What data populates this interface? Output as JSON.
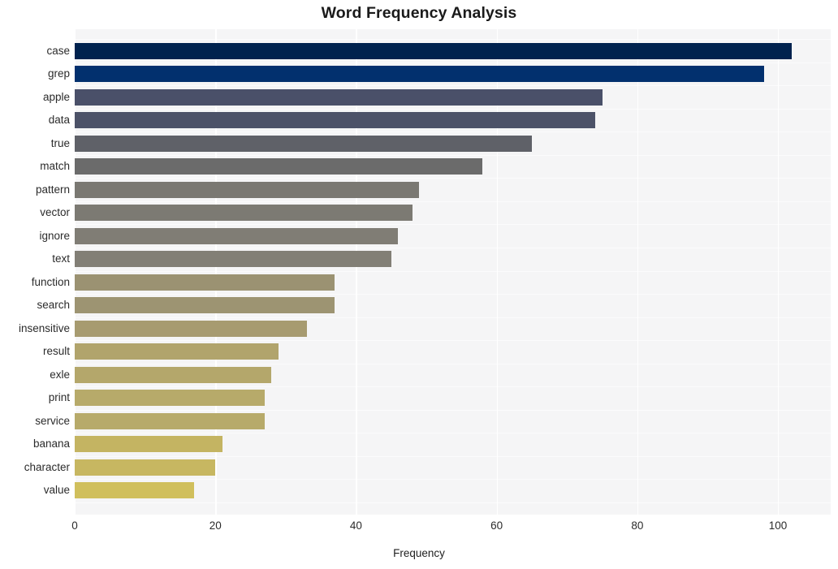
{
  "chart_data": {
    "type": "bar",
    "orientation": "horizontal",
    "title": "Word Frequency Analysis",
    "xlabel": "Frequency",
    "ylabel": "",
    "categories": [
      "case",
      "grep",
      "apple",
      "data",
      "true",
      "match",
      "pattern",
      "vector",
      "ignore",
      "text",
      "function",
      "search",
      "insensitive",
      "result",
      "exle",
      "print",
      "service",
      "banana",
      "character",
      "value"
    ],
    "values": [
      102,
      98,
      75,
      74,
      65,
      58,
      49,
      48,
      46,
      45,
      37,
      37,
      33,
      29,
      28,
      27,
      27,
      21,
      20,
      17
    ],
    "bar_colors": [
      "#00224e",
      "#02306e",
      "#4a5069",
      "#4c5268",
      "#5f6168",
      "#6b6b6b",
      "#7a7872",
      "#7c7a73",
      "#807d75",
      "#827f76",
      "#9b9272",
      "#9d9472",
      "#a79b70",
      "#b1a46c",
      "#b4a76b",
      "#b7aa6a",
      "#b7aa6a",
      "#c4b462",
      "#c7b761",
      "#d0bf5c"
    ],
    "xticks": [
      0,
      20,
      40,
      60,
      80,
      100
    ],
    "xlim": [
      0,
      107.5
    ],
    "grid": {
      "vertical": true,
      "horizontal": true,
      "color": "#ffffff"
    },
    "plot_background": "#f5f5f6",
    "figure_background": "#ffffff",
    "colormap": "cividis",
    "legend": null
  }
}
